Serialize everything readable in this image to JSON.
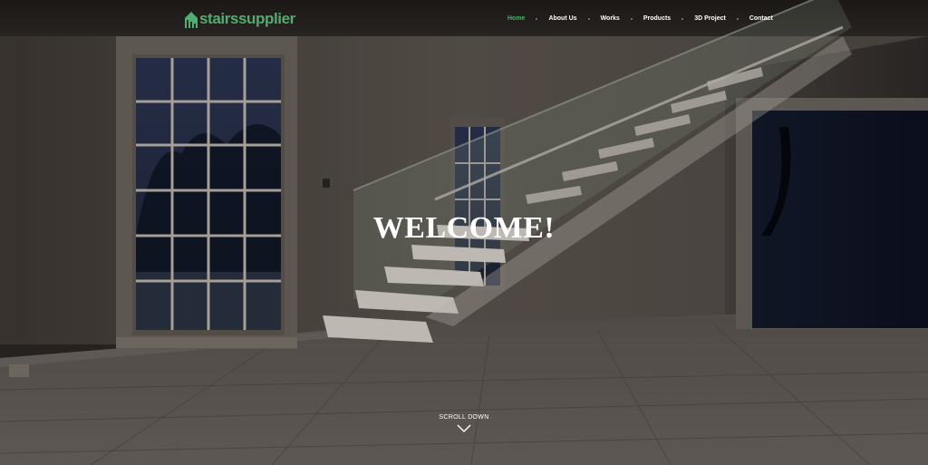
{
  "brand": {
    "logo_part1": "stairs",
    "logo_part2": "supplier",
    "accent_color": "#4fae6f"
  },
  "nav": {
    "items": [
      {
        "label": "Home",
        "active": true
      },
      {
        "label": "About Us",
        "active": false
      },
      {
        "label": "Works",
        "active": false
      },
      {
        "label": "Products",
        "active": false
      },
      {
        "label": "3D Project",
        "active": false
      },
      {
        "label": "Contact",
        "active": false
      }
    ]
  },
  "hero": {
    "title": "WELCOME!",
    "scroll_label": "SCROLL DOWN",
    "scroll_icon": "chevron-down-icon",
    "background": "interior-with-glass-staircase"
  }
}
